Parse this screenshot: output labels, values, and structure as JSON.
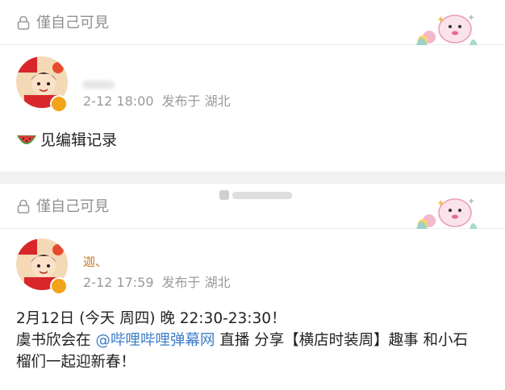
{
  "posts": [
    {
      "privacy": "僅自己可見",
      "time": "2-12 18:00",
      "location": "发布于 湖北",
      "text": "见编辑记录"
    },
    {
      "privacy": "僅自己可見",
      "username": "迦、",
      "time": "2-12 17:59",
      "location": "发布于 湖北",
      "text_line1": "2月12日 (今天 周四) 晚 22:30-23:30！",
      "text_line2_prefix": "虞书欣会在 ",
      "mention": "@哔哩哔哩弹幕网",
      "text_line2_suffix": " 直播 分享【横店时装周】趣事 和小石",
      "text_line3": "榴们一起迎新春！"
    }
  ],
  "colors": {
    "mention": "#3f7ec7",
    "meta_text": "#9a9a9a",
    "privacy_text": "#8f8f8f",
    "verified_badge": "#f3a418"
  }
}
